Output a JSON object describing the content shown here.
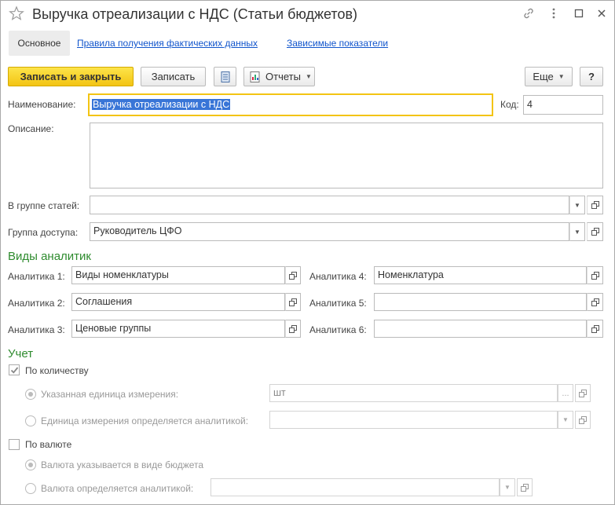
{
  "window": {
    "title": "Выручка отреализации с НДС (Статьи бюджетов)"
  },
  "tabs": [
    {
      "label": "Основное"
    },
    {
      "label": "Правила получения фактических данных"
    },
    {
      "label": "Зависимые показатели"
    }
  ],
  "toolbar": {
    "save_close": "Записать и закрыть",
    "save": "Записать",
    "reports": "Отчеты",
    "more": "Еще",
    "help": "?"
  },
  "form": {
    "name_label": "Наименование:",
    "name_value": "Выручка отреализации с НДС",
    "code_label": "Код:",
    "code_value": "4",
    "description_label": "Описание:",
    "description_value": "",
    "group_label": "В группе статей:",
    "group_value": "",
    "access_label": "Группа доступа:",
    "access_value": "Руководитель ЦФО"
  },
  "analytics": {
    "title": "Виды аналитик",
    "items": [
      {
        "label": "Аналитика 1:",
        "value": "Виды номенклатуры"
      },
      {
        "label": "Аналитика 2:",
        "value": "Соглашения"
      },
      {
        "label": "Аналитика 3:",
        "value": "Ценовые группы"
      },
      {
        "label": "Аналитика 4:",
        "value": "Номенклатура"
      },
      {
        "label": "Аналитика 5:",
        "value": ""
      },
      {
        "label": "Аналитика 6:",
        "value": ""
      }
    ]
  },
  "accounting": {
    "title": "Учет",
    "by_quantity_label": "По количеству",
    "by_quantity_checked": true,
    "unit_specified_label": "Указанная единица измерения:",
    "unit_value": "шт",
    "unit_by_analytics_label": "Единица измерения определяется аналитикой:",
    "unit_by_analytics_value": "",
    "by_currency_label": "По валюте",
    "by_currency_checked": false,
    "currency_budget_label": "Валюта указывается в виде бюджета",
    "currency_by_analytics_label": "Валюта определяется аналитикой:",
    "currency_by_analytics_value": ""
  }
}
